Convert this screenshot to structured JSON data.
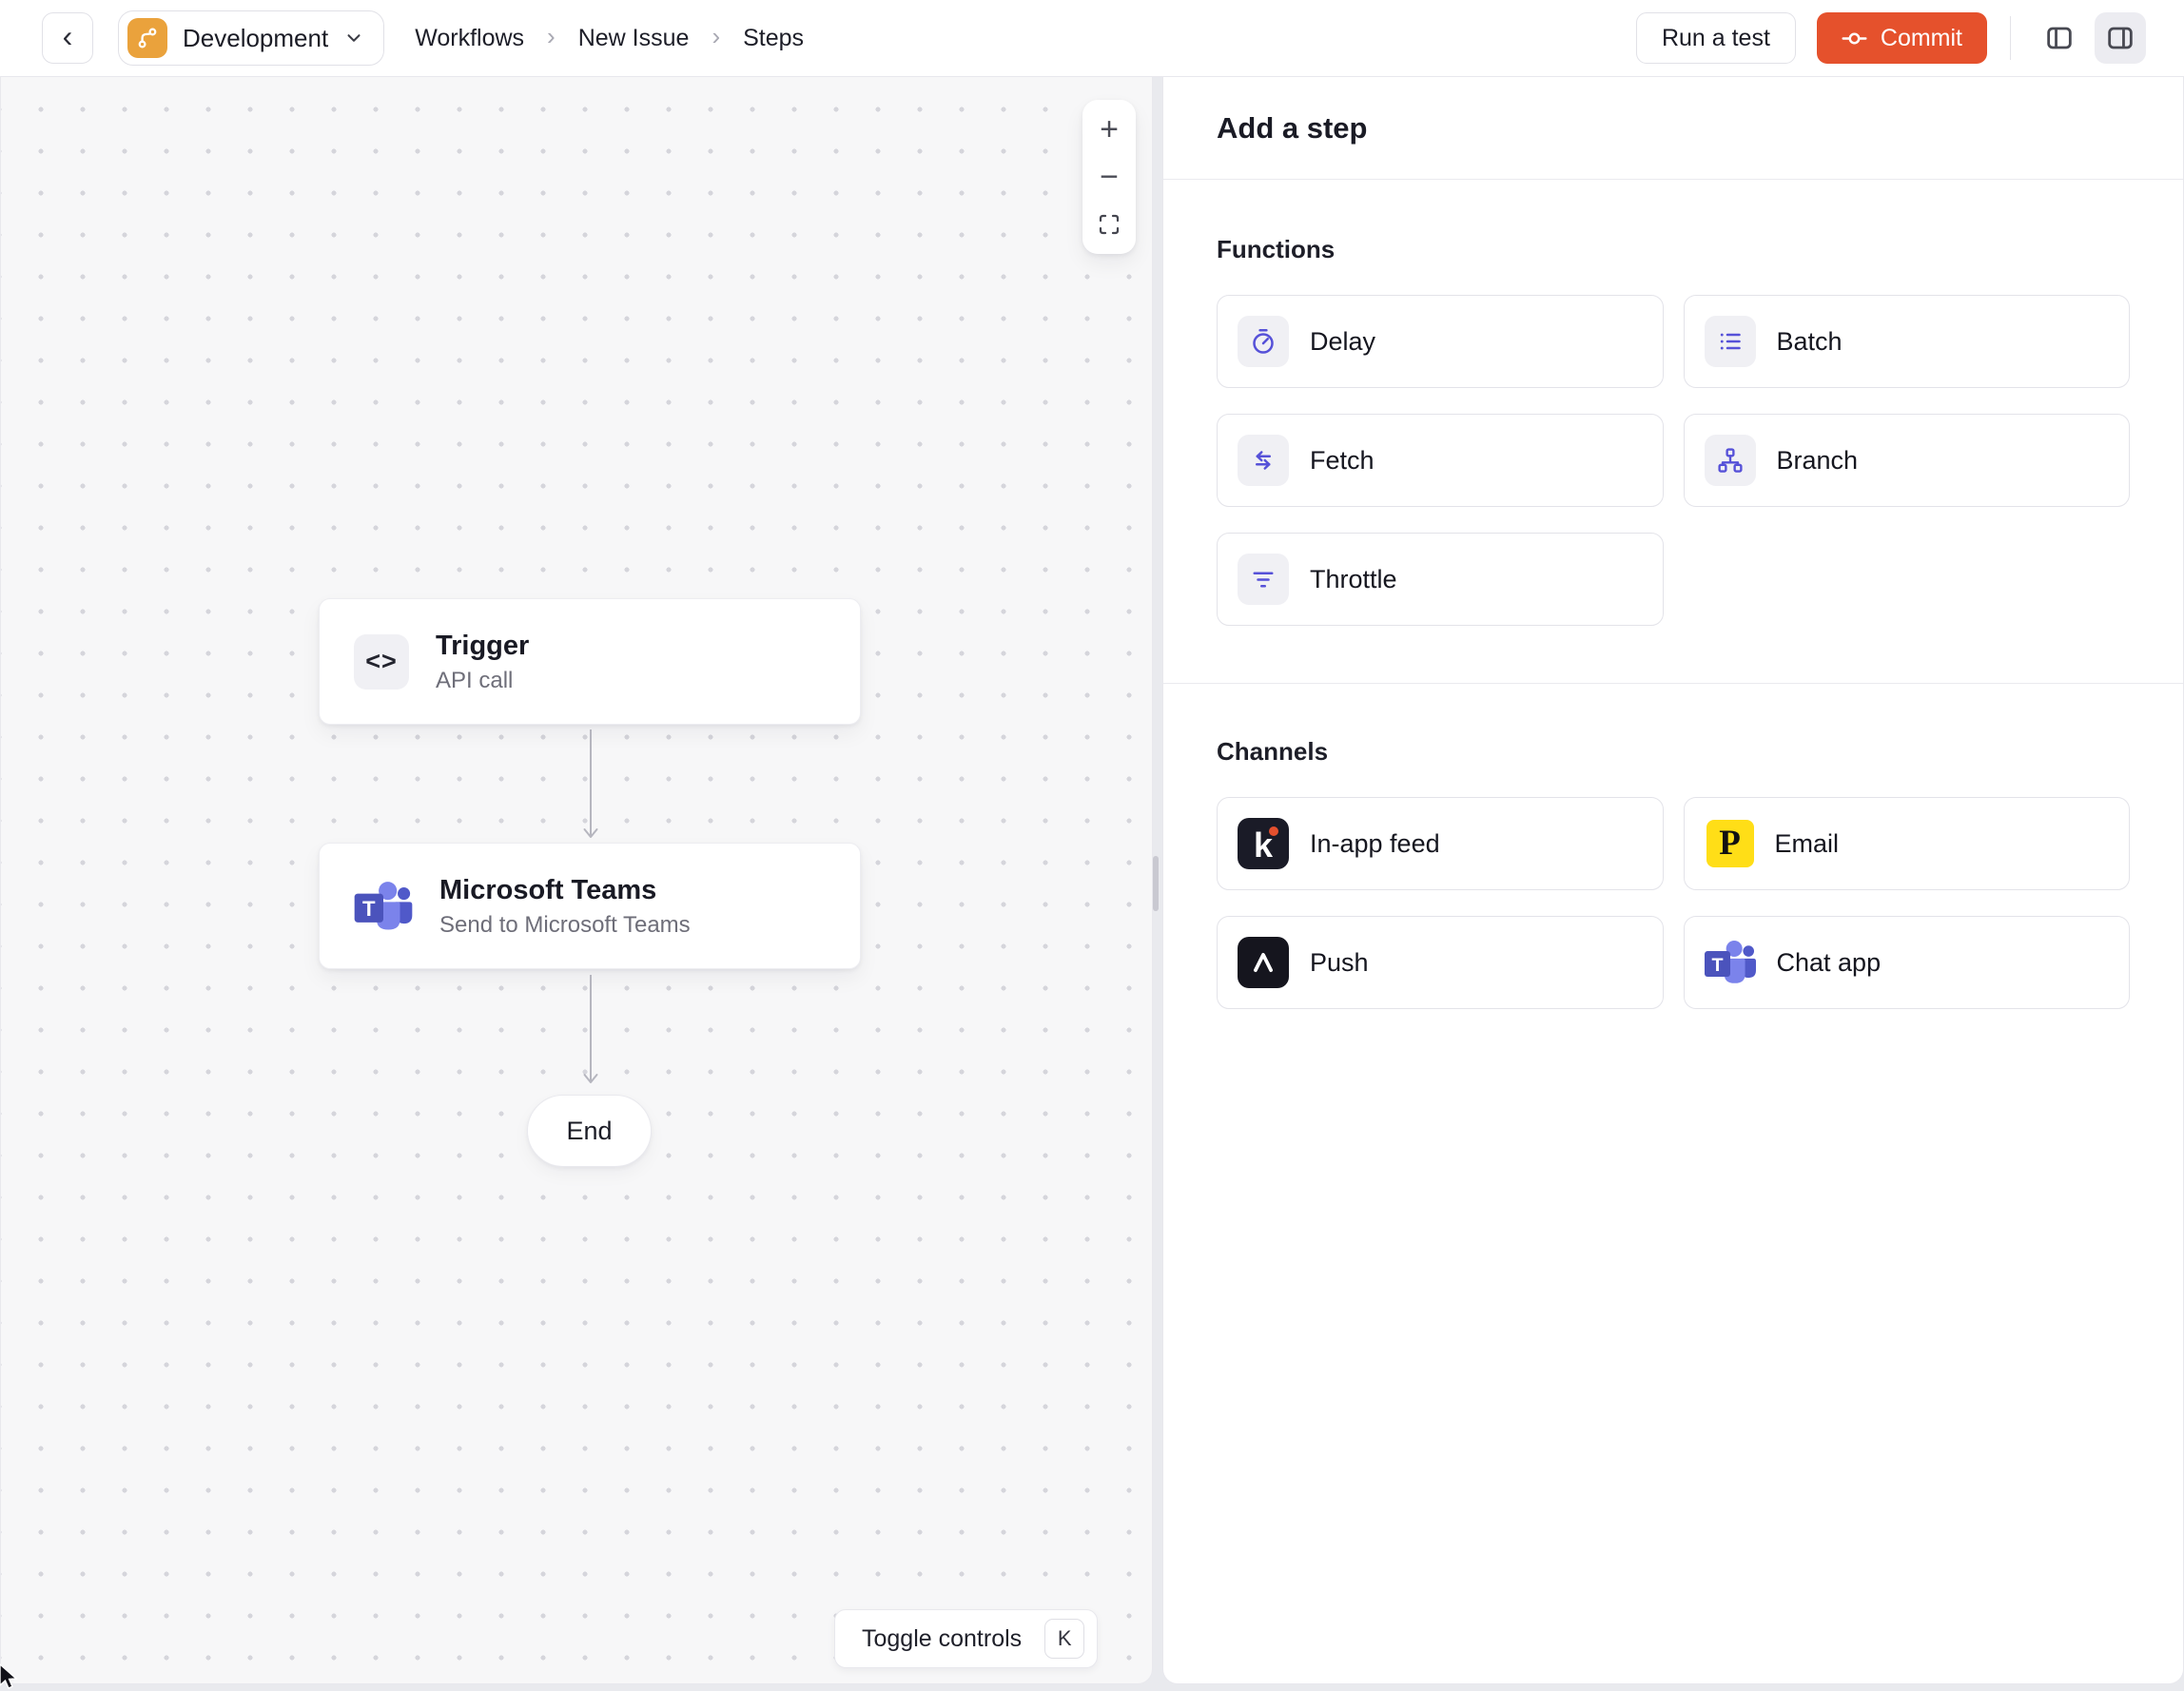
{
  "header": {
    "back_icon": "‹",
    "environment": {
      "label": "Development"
    },
    "breadcrumbs": {
      "items": [
        "Workflows",
        "New Issue",
        "Steps"
      ],
      "separator": "›"
    },
    "actions": {
      "run_test": "Run a test",
      "commit": "Commit"
    }
  },
  "canvas": {
    "zoom_controls": {
      "zoom_in": "+",
      "zoom_out": "−"
    },
    "nodes": {
      "trigger": {
        "icon": "<>",
        "title": "Trigger",
        "subtitle": "API call"
      },
      "teams": {
        "title": "Microsoft Teams",
        "subtitle": "Send to Microsoft Teams"
      },
      "end": {
        "label": "End"
      }
    },
    "toggle_controls": {
      "label": "Toggle controls",
      "shortcut": "K"
    }
  },
  "panel": {
    "title": "Add a step",
    "functions": {
      "label": "Functions",
      "items": [
        {
          "label": "Delay",
          "icon": "delay-stopwatch-icon"
        },
        {
          "label": "Batch",
          "icon": "batch-list-icon"
        },
        {
          "label": "Fetch",
          "icon": "fetch-arrows-icon"
        },
        {
          "label": "Branch",
          "icon": "branch-tree-icon"
        },
        {
          "label": "Throttle",
          "icon": "throttle-lines-icon"
        }
      ]
    },
    "channels": {
      "label": "Channels",
      "items": [
        {
          "label": "In-app feed",
          "icon": "knock-logo",
          "letter": "k"
        },
        {
          "label": "Email",
          "icon": "postmark-logo",
          "letter": "P"
        },
        {
          "label": "Push",
          "icon": "expo-logo"
        },
        {
          "label": "Chat app",
          "icon": "microsoft-teams-logo",
          "letter": "T"
        }
      ]
    }
  },
  "colors": {
    "commit_orange": "#e5512c",
    "environment_orange": "#eaa23c",
    "function_icon_indigo": "#5651d8",
    "knock_dark": "#1a1b27",
    "knock_dot": "#e4502e",
    "postmark_yellow": "#ffde17",
    "expo_dark": "#15151e",
    "teams_purple": "#4b53bc",
    "canvas_dot": "#d5d5db"
  }
}
